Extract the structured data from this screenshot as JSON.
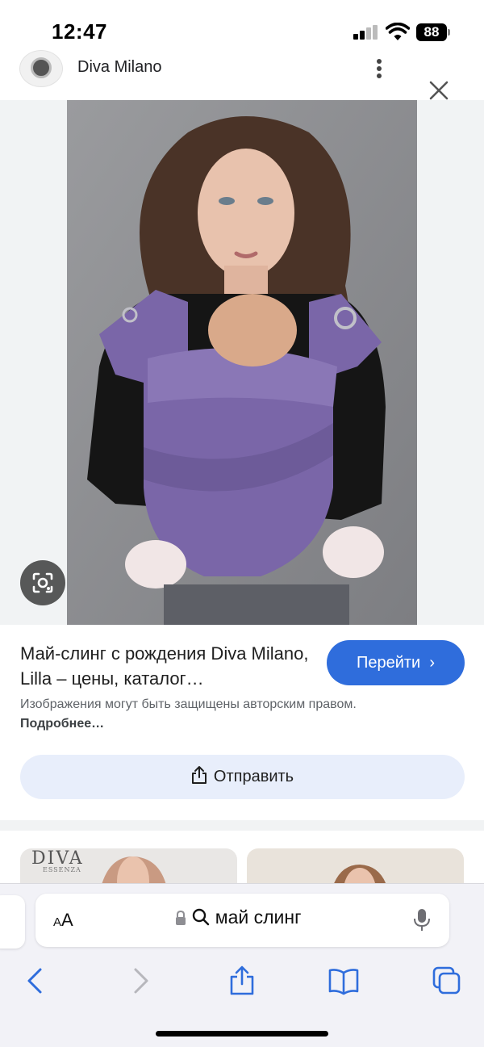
{
  "status_bar": {
    "time": "12:47",
    "battery": "88"
  },
  "site": {
    "name": "Diva Milano",
    "icon": "site-logo"
  },
  "result": {
    "title": "Май-слинг с рождения Diva Milano, Lilla – цены, каталог…",
    "go_label": "Перейти",
    "copyright_text": "Изображения могут быть защищены авторским правом.",
    "copyright_more": "Подробнее…",
    "share_label": "Отправить"
  },
  "thumbnails": {
    "first_brand": "DIVA",
    "first_sub": "ESSENZA"
  },
  "browser": {
    "aa_small": "A",
    "aa_large": "A",
    "url_text": "май слинг"
  },
  "colors": {
    "accent": "#2f6ddc",
    "share_bg": "#e8eefb",
    "sling": "#7a66a8"
  }
}
